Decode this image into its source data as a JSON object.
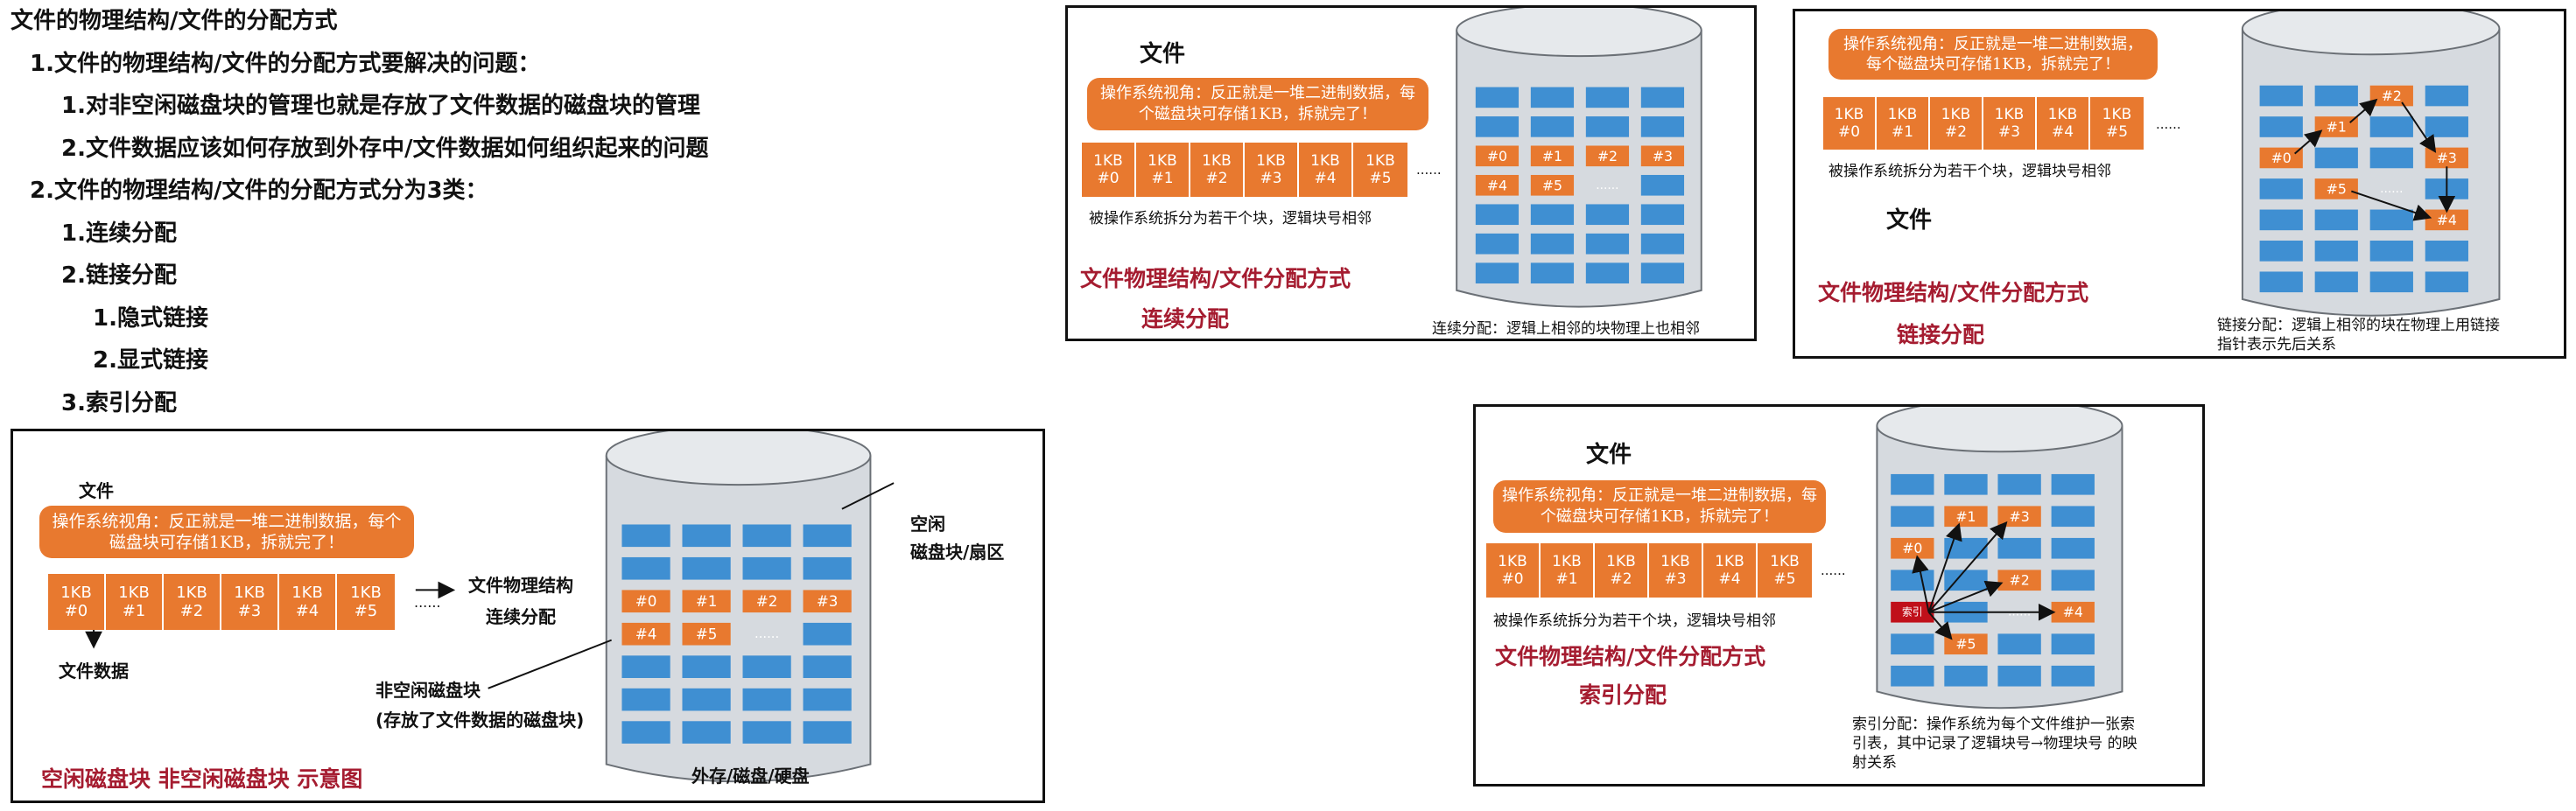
{
  "outline": [
    "文件的物理结构/文件的分配方式",
    "1.文件的物理结构/文件的分配方式要解决的问题：",
    "1.对非空闲磁盘块的管理也就是存放了文件数据的磁盘块的管理",
    "2.文件数据应该如何存放到外存中/文件数据如何组织起来的问题",
    "2.文件的物理结构/文件的分配方式分为3类：",
    "1.连续分配",
    "2.链接分配",
    "1.隐式链接",
    "2.显式链接",
    "3.索引分配"
  ],
  "common": {
    "file_label": "文件",
    "bubble": "操作系统视角：反正就是一堆二进制数据，每个磁盘块可存储1KB，拆就完了！",
    "cell_size": "1KB",
    "cell_ids": [
      "#0",
      "#1",
      "#2",
      "#3",
      "#4",
      "#5"
    ],
    "ellipsis": "......",
    "split_note": "被操作系统拆分为若干个块，逻辑块号相邻",
    "heading": "文件物理结构/文件分配方式"
  },
  "main_panel": {
    "file_data": "文件数据",
    "arrow_label_1": "文件物理结构",
    "arrow_label_2": "连续分配",
    "free_label_1": "空闲",
    "free_label_2": "磁盘块/扇区",
    "nonfree_label_1": "非空闲磁盘块",
    "nonfree_label_2": "(存放了文件数据的磁盘块)",
    "disk_label": "外存/磁盘/硬盘",
    "caption": "空闲磁盘块 非空闲磁盘块 示意图"
  },
  "contiguous_panel": {
    "subheading": "连续分配",
    "note": "连续分配：逻辑上相邻的块物理上也相邻"
  },
  "linked_panel": {
    "subheading": "链接分配",
    "note_line1": "链接分配：逻辑上相邻的块在物理上用链接",
    "note_line2": "指针表示先后关系"
  },
  "indexed_panel": {
    "subheading": "索引分配",
    "index_block": "索引",
    "note_line1": "索引分配：操作系统为每个文件维护一张索",
    "note_line2": "引表，其中记录了逻辑块号→物理块号 的映",
    "note_line3": "射关系"
  },
  "colors": {
    "orange": "#e8792f",
    "blue": "#3f8fd2",
    "disk": "#d6dadf",
    "red_text": "#a51c30",
    "index_red": "#c0101a"
  }
}
